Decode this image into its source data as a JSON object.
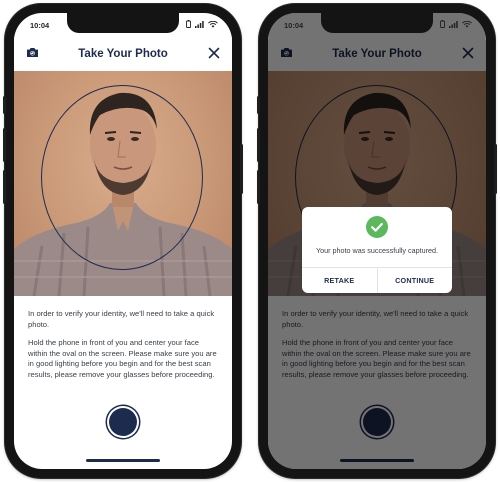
{
  "status_bar": {
    "time": "10:04"
  },
  "header": {
    "title": "Take Your Photo"
  },
  "instructions": {
    "paragraph_1": "In order to verify your identity, we'll need to take a quick photo.",
    "paragraph_2": "Hold the phone in front of you and center your face within the oval on the screen. Please make sure you are in good lighting before you begin and for the best scan results, please remove your glasses before proceeding."
  },
  "dialog": {
    "message": "Your photo was successfully captured.",
    "retake_label": "RETAKE",
    "continue_label": "CONTINUE"
  },
  "icons": {
    "camera": "camera-switch-icon",
    "close": "close-icon",
    "success": "checkmark-icon",
    "battery": "battery-icon",
    "signal": "signal-icon",
    "wifi": "wifi-icon"
  },
  "colors": {
    "primary": "#1d2b4f",
    "success": "#5cb85c",
    "overlay": "rgba(0,0,0,0.55)",
    "text": "#3a3f4b"
  }
}
